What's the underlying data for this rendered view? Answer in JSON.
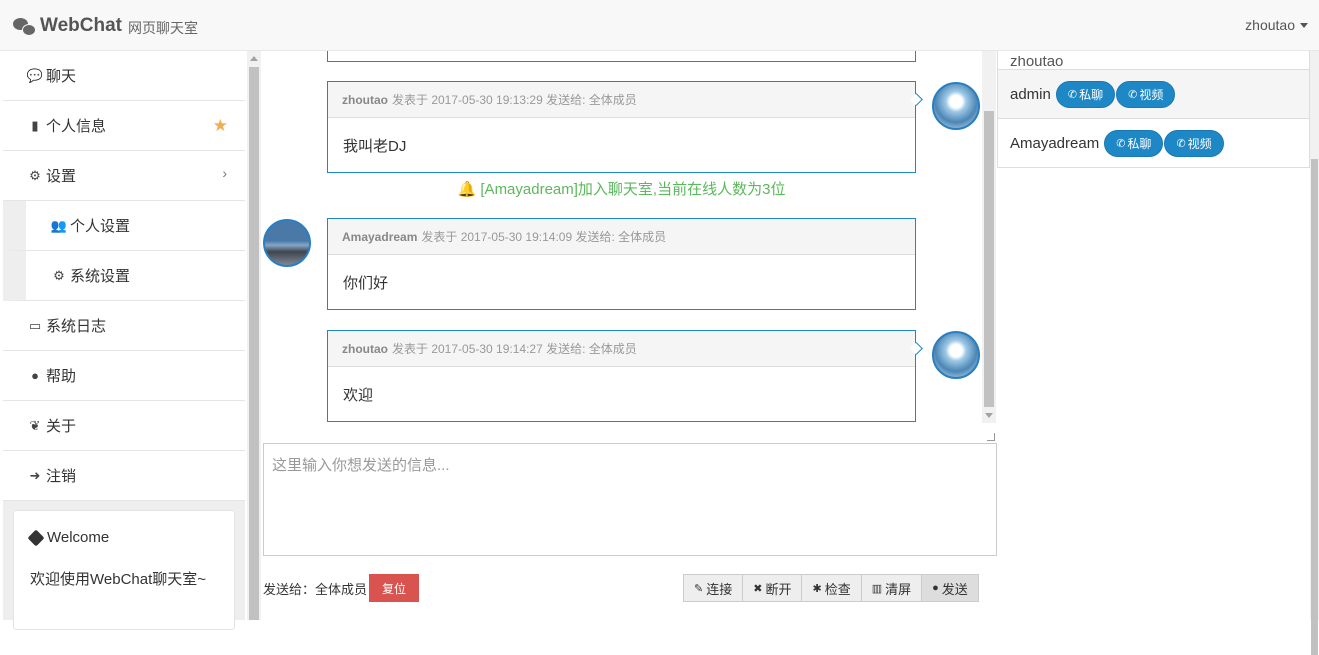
{
  "navbar": {
    "brand": "WebChat",
    "subtitle": "网页聊天室",
    "user": "zhoutao"
  },
  "sidebar": {
    "items": [
      {
        "label": "聊天",
        "icon": "comment-icon"
      },
      {
        "label": "个人信息",
        "icon": "book-icon"
      },
      {
        "label": "设置",
        "icon": "cogs-icon"
      },
      {
        "label": "个人设置",
        "icon": "users-icon"
      },
      {
        "label": "系统设置",
        "icon": "gear-icon"
      },
      {
        "label": "系统日志",
        "icon": "inbox-icon"
      },
      {
        "label": "帮助",
        "icon": "globe-icon"
      },
      {
        "label": "关于",
        "icon": "leaf-icon"
      },
      {
        "label": "注销",
        "icon": "sign-out-icon"
      }
    ],
    "welcome_title": "Welcome",
    "welcome_text": "欢迎使用WebChat聊天室~"
  },
  "chat": {
    "messages": [
      {
        "user": "zhoutao",
        "meta": "发表于 2017-05-30 19:13:29 发送给: 全体成员",
        "text": "我叫老DJ"
      },
      {
        "user": "Amayadream",
        "meta": "发表于 2017-05-30 19:14:09 发送给: 全体成员",
        "text": "你们好"
      },
      {
        "user": "zhoutao",
        "meta": "发表于 2017-05-30 19:14:27 发送给: 全体成员",
        "text": "欢迎"
      }
    ],
    "notice": "[Amayadream]加入聊天室,当前在线人数为3位"
  },
  "composer": {
    "placeholder": "这里输入你想发送的信息...",
    "sendto_label": "发送给：全体成员",
    "reset_label": "复位",
    "buttons": [
      "连接",
      "断开",
      "检查",
      "清屏",
      "发送"
    ]
  },
  "userlist": {
    "cut_name": "zhoutao",
    "users": [
      {
        "name": "admin",
        "chat_label": "私聊",
        "video_label": "视频"
      },
      {
        "name": "Amayadream",
        "chat_label": "私聊",
        "video_label": "视频"
      }
    ]
  },
  "colors": {
    "accent": "#1e88c7",
    "notice": "#5cb85c",
    "danger": "#d9534f",
    "star": "#f0ad4e"
  }
}
